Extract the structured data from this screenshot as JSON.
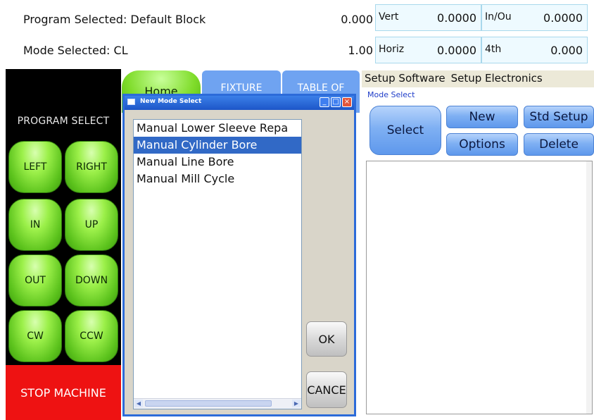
{
  "status": {
    "program_selected": "Program Selected: Default Block",
    "mode_selected": "Mode Selected: CL",
    "readout_1": "0.000",
    "readout_2": "1.00"
  },
  "axes": [
    {
      "label": "Vert",
      "value": "0.0000"
    },
    {
      "label": "In/Ou",
      "value": "0.0000"
    },
    {
      "label": "Horiz",
      "value": "0.0000"
    },
    {
      "label": "4th",
      "value": "0.000"
    }
  ],
  "program_select": {
    "title": "PROGRAM SELECT",
    "buttons": [
      "LEFT",
      "RIGHT",
      "IN",
      "UP",
      "OUT",
      "DOWN",
      "CW",
      "CCW"
    ],
    "stop": "STOP MACHINE"
  },
  "tabs": {
    "home": "Home",
    "fixture": "FIXTURE",
    "table_of": "TABLE OF"
  },
  "setup": {
    "tabs": [
      "Setup Software",
      "Setup Electronics"
    ],
    "mode_select_label": "Mode Select",
    "buttons": {
      "select": "Select",
      "new": "New",
      "std_setup": "Std Setup",
      "options": "Options",
      "delete": "Delete"
    }
  },
  "dialog": {
    "title": "New Mode Select",
    "items": [
      "Manual Lower Sleeve Repa",
      "Manual Cylinder Bore",
      "Manual Line Bore",
      "Manual Mill Cycle"
    ],
    "selected_index": 1,
    "ok": "OK",
    "cancel": "CANCE"
  },
  "colors": {
    "accent_blue": "#3169c6",
    "stop_red": "#ee1212",
    "button_green": "#7fdc2a"
  }
}
